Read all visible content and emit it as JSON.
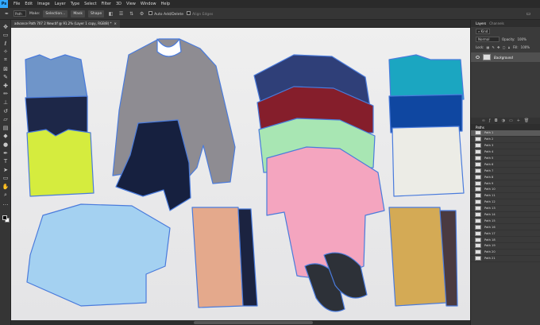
{
  "menubar": {
    "logo": "Ps",
    "items": [
      "File",
      "Edit",
      "Image",
      "Layer",
      "Type",
      "Select",
      "Filter",
      "3D",
      "View",
      "Window",
      "Help"
    ]
  },
  "options": {
    "tool_mode": "Path",
    "make_label": "Make:",
    "selection_button": "Selection...",
    "mask_button": "Mask",
    "shape_button": "Shape",
    "auto_add_delete": "Auto Add/Delete",
    "align_edges": "Align Edges"
  },
  "document": {
    "tab_title": "advance Path 707 2 New.tif @ 91.2% (Layer 1 copy, RGB/8) *",
    "close": "×"
  },
  "layers_panel": {
    "tab_layers": "Layers",
    "tab_channels": "Channels",
    "kind_label": "Kind",
    "blend_mode": "Normal",
    "opacity_label": "Opacity:",
    "opacity_value": "100%",
    "lock_label": "Lock:",
    "fill_label": "Fill:",
    "fill_value": "100%",
    "layer_name": "Background"
  },
  "paths_panel": {
    "title": "Paths",
    "items": [
      "Path 1",
      "Path 2",
      "Path 3",
      "Path 4",
      "Path 5",
      "Path 6",
      "Path 7",
      "Path 8",
      "Path 9",
      "Path 10",
      "Path 11",
      "Path 12",
      "Path 13",
      "Path 14",
      "Path 15",
      "Path 16",
      "Path 17",
      "Path 18",
      "Path 19",
      "Path 20",
      "Path 21"
    ]
  },
  "colors": {
    "accent": "#31a8ff",
    "path_outline": "#4a7bdc"
  }
}
